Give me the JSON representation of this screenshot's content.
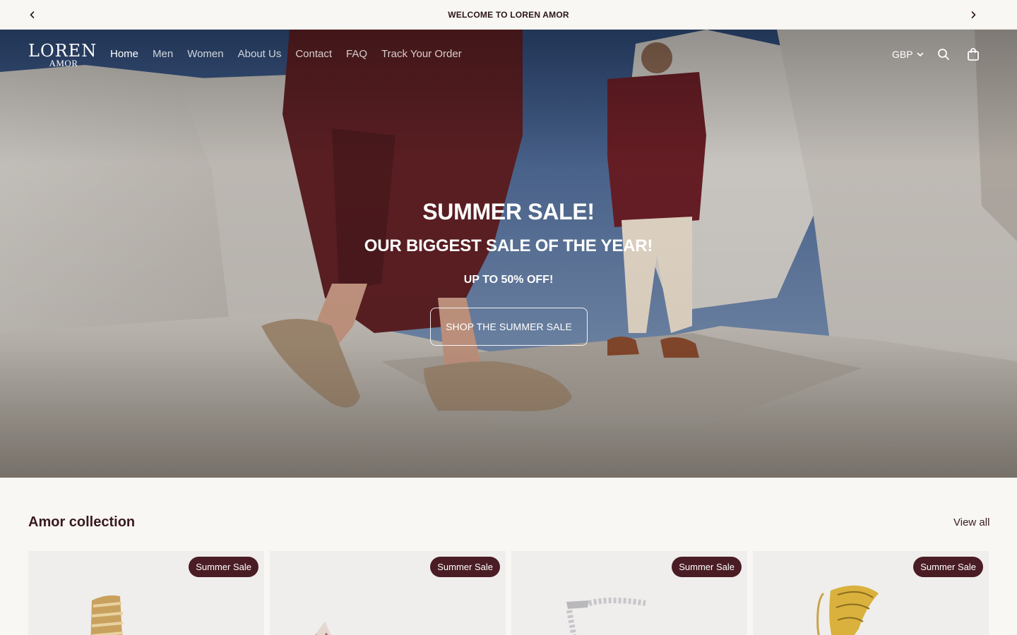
{
  "announcement": {
    "text": "WELCOME TO LOREN AMOR",
    "prev_icon": "chevron-left-icon",
    "next_icon": "chevron-right-icon"
  },
  "header": {
    "logo": {
      "top": "LOREN",
      "bottom": "AMOR"
    },
    "nav": [
      {
        "label": "Home",
        "active": true
      },
      {
        "label": "Men"
      },
      {
        "label": "Women"
      },
      {
        "label": "About Us"
      },
      {
        "label": "Contact"
      },
      {
        "label": "FAQ"
      },
      {
        "label": "Track Your Order"
      }
    ],
    "currency": "GBP",
    "icons": {
      "search": "search-icon",
      "cart": "shopping-bag-icon"
    }
  },
  "hero": {
    "title": "SUMMER SALE!",
    "subtitle": "OUR BIGGEST SALE OF THE YEAR!",
    "discount": "UP TO 50% OFF!",
    "button": "SHOP THE SUMMER SALE"
  },
  "collection": {
    "title": "Amor collection",
    "view_all": "View all",
    "products": [
      {
        "badge": "Summer Sale"
      },
      {
        "badge": "Summer Sale"
      },
      {
        "badge": "Summer Sale"
      },
      {
        "badge": "Summer Sale"
      }
    ]
  },
  "colors": {
    "brand": "#4a1c24",
    "background": "#f8f7f4",
    "text": "#2b1518"
  }
}
